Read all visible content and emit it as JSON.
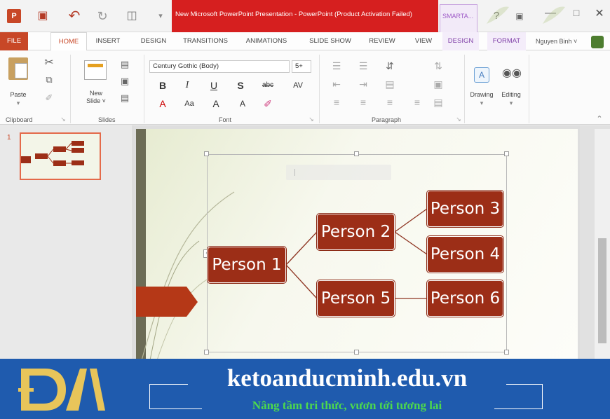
{
  "window": {
    "title": "New Microsoft PowerPoint Presentation - PowerPoint (Product Activation Failed)",
    "contextual_tab_header": "SMARTA...",
    "accent_color": "#c84727"
  },
  "quick_access": {
    "app_logo": "powerpoint-icon",
    "save": "save-icon",
    "undo": "undo-icon",
    "redo": "redo-icon",
    "present": "present-icon"
  },
  "tabs": {
    "file": "FILE",
    "home": "HOME",
    "insert": "INSERT",
    "design": "DESIGN",
    "transitions": "TRANSITIONS",
    "animations": "ANIMATIONS",
    "slideshow": "SLIDE SHOW",
    "review": "REVIEW",
    "view": "VIEW",
    "smartart_design": "DESIGN",
    "format": "FORMAT"
  },
  "user": {
    "name": "Nguyen Binh ˅"
  },
  "ribbon": {
    "clipboard": {
      "label": "Clipboard",
      "paste": "Paste"
    },
    "slides": {
      "label": "Slides",
      "new_slide": "New\nSlide ˅"
    },
    "font": {
      "label": "Font",
      "family": "Century Gothic (Body)",
      "size": "5+"
    },
    "paragraph": {
      "label": "Paragraph"
    },
    "drawing": {
      "label": "Drawing"
    },
    "editing": {
      "label": "Editing"
    }
  },
  "thumbnails": {
    "slide_number": "1"
  },
  "smartart": {
    "node_color": "#9c2e17",
    "nodes": {
      "p1": "Person 1",
      "p2": "Person 2",
      "p3": "Person 3",
      "p4": "Person 4",
      "p5": "Person 5",
      "p6": "Person 6"
    }
  },
  "banner": {
    "color": "#1f5bae",
    "brand": "ketoanducminh.edu.vn",
    "tagline": "Nâng tầm tri thức, vươn tới tương lai"
  }
}
